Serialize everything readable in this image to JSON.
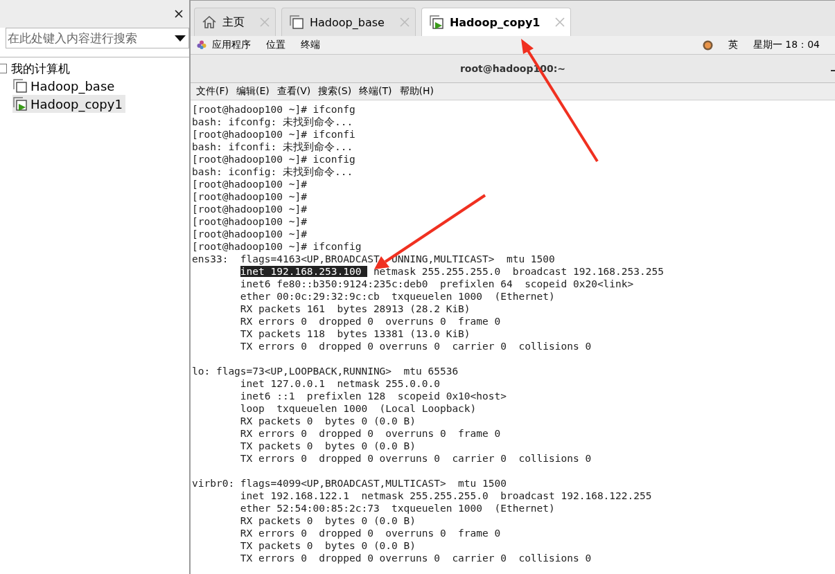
{
  "sidebar": {
    "search": {
      "placeholder": "在此处键入内容进行搜索"
    },
    "tree": [
      {
        "label": "我的计算机",
        "children": [
          {
            "label": "Hadoop_base",
            "running": false,
            "selected": false
          },
          {
            "label": "Hadoop_copy1",
            "running": true,
            "selected": true
          }
        ]
      }
    ]
  },
  "tabs": [
    {
      "label": "主页",
      "kind": "home",
      "selected": false
    },
    {
      "label": "Hadoop_base",
      "kind": "vm",
      "running": false,
      "selected": false
    },
    {
      "label": "Hadoop_copy1",
      "kind": "vm",
      "running": true,
      "selected": true
    }
  ],
  "top_bar": {
    "menus": [
      "应用程序",
      "位置",
      "终端"
    ],
    "input_method": "英",
    "clock": "星期一 18：04"
  },
  "terminal": {
    "title": "root@hadoop100:~",
    "menus": [
      "文件(F)",
      "编辑(E)",
      "查看(V)",
      "搜索(S)",
      "终端(T)",
      "帮助(H)"
    ],
    "lines": [
      {
        "text": "[root@hadoop100 ~]# ifconfg"
      },
      {
        "text": "bash: ifconfg: 未找到命令..."
      },
      {
        "text": "[root@hadoop100 ~]# ifconfi"
      },
      {
        "text": "bash: ifconfi: 未找到命令..."
      },
      {
        "text": "[root@hadoop100 ~]# iconfig"
      },
      {
        "text": "bash: iconfig: 未找到命令..."
      },
      {
        "text": "[root@hadoop100 ~]#"
      },
      {
        "text": "[root@hadoop100 ~]#"
      },
      {
        "text": "[root@hadoop100 ~]#"
      },
      {
        "text": "[root@hadoop100 ~]#"
      },
      {
        "text": "[root@hadoop100 ~]#"
      },
      {
        "text": "[root@hadoop100 ~]# ifconfig"
      },
      {
        "parts": [
          {
            "text": "ens33:  flags=4163<UP,BROADCAST",
            "selected": false
          },
          {
            "text": "UNNING,MULTICAST>  mtu 1500",
            "selected": false,
            "after_covered": true
          }
        ]
      },
      {
        "indented": true,
        "parts": [
          {
            "text": "inet 192.168.253.100 ",
            "selected": true
          },
          {
            "text": " netmask 255.255.255.0  broadcast 192.168.253.255",
            "selected": false
          }
        ]
      },
      {
        "text": "        inet6 fe80::b350:9124:235c:deb0  prefixlen 64  scopeid 0x20<link>"
      },
      {
        "text": "        ether 00:0c:29:32:9c:cb  txqueuelen 1000  (Ethernet)"
      },
      {
        "text": "        RX packets 161  bytes 28913 (28.2 KiB)"
      },
      {
        "text": "        RX errors 0  dropped 0  overruns 0  frame 0"
      },
      {
        "text": "        TX packets 118  bytes 13381 (13.0 KiB)"
      },
      {
        "text": "        TX errors 0  dropped 0 overruns 0  carrier 0  collisions 0"
      },
      {
        "gap_before": true,
        "text": "lo: flags=73<UP,LOOPBACK,RUNNING>  mtu 65536"
      },
      {
        "text": "        inet 127.0.0.1  netmask 255.0.0.0"
      },
      {
        "text": "        inet6 ::1  prefixlen 128  scopeid 0x10<host>"
      },
      {
        "text": "        loop  txqueuelen 1000  (Local Loopback)"
      },
      {
        "text": "        RX packets 0  bytes 0 (0.0 B)"
      },
      {
        "text": "        RX errors 0  dropped 0  overruns 0  frame 0"
      },
      {
        "text": "        TX packets 0  bytes 0 (0.0 B)"
      },
      {
        "text": "        TX errors 0  dropped 0 overruns 0  carrier 0  collisions 0"
      },
      {
        "gap_before": true,
        "text": "virbr0: flags=4099<UP,BROADCAST,MULTICAST>  mtu 1500"
      },
      {
        "text": "        inet 192.168.122.1  netmask 255.255.255.0  broadcast 192.168.122.255"
      },
      {
        "text": "        ether 52:54:00:85:2c:73  txqueuelen 1000  (Ethernet)"
      },
      {
        "text": "        RX packets 0  bytes 0 (0.0 B)"
      },
      {
        "text": "        RX errors 0  dropped 0  overruns 0  frame 0"
      },
      {
        "text": "        TX packets 0  bytes 0 (0.0 B)"
      },
      {
        "text": "        TX errors 0  dropped 0 overruns 0  carrier 0  collisions 0"
      }
    ]
  }
}
